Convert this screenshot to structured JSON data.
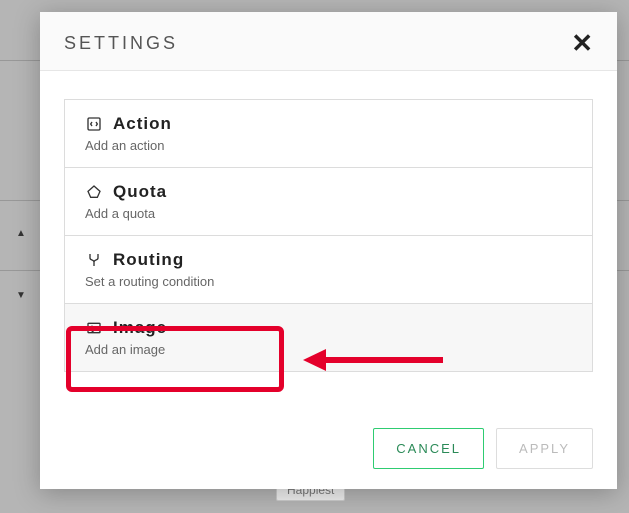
{
  "modal": {
    "title": "SETTINGS",
    "options": [
      {
        "title": "Action",
        "subtitle": "Add an action"
      },
      {
        "title": "Quota",
        "subtitle": "Add a quota"
      },
      {
        "title": "Routing",
        "subtitle": "Set a routing condition"
      },
      {
        "title": "Image",
        "subtitle": "Add an image"
      }
    ],
    "buttons": {
      "cancel": "CANCEL",
      "apply": "APPLY"
    }
  },
  "background": {
    "pill_label": "Happiest"
  }
}
